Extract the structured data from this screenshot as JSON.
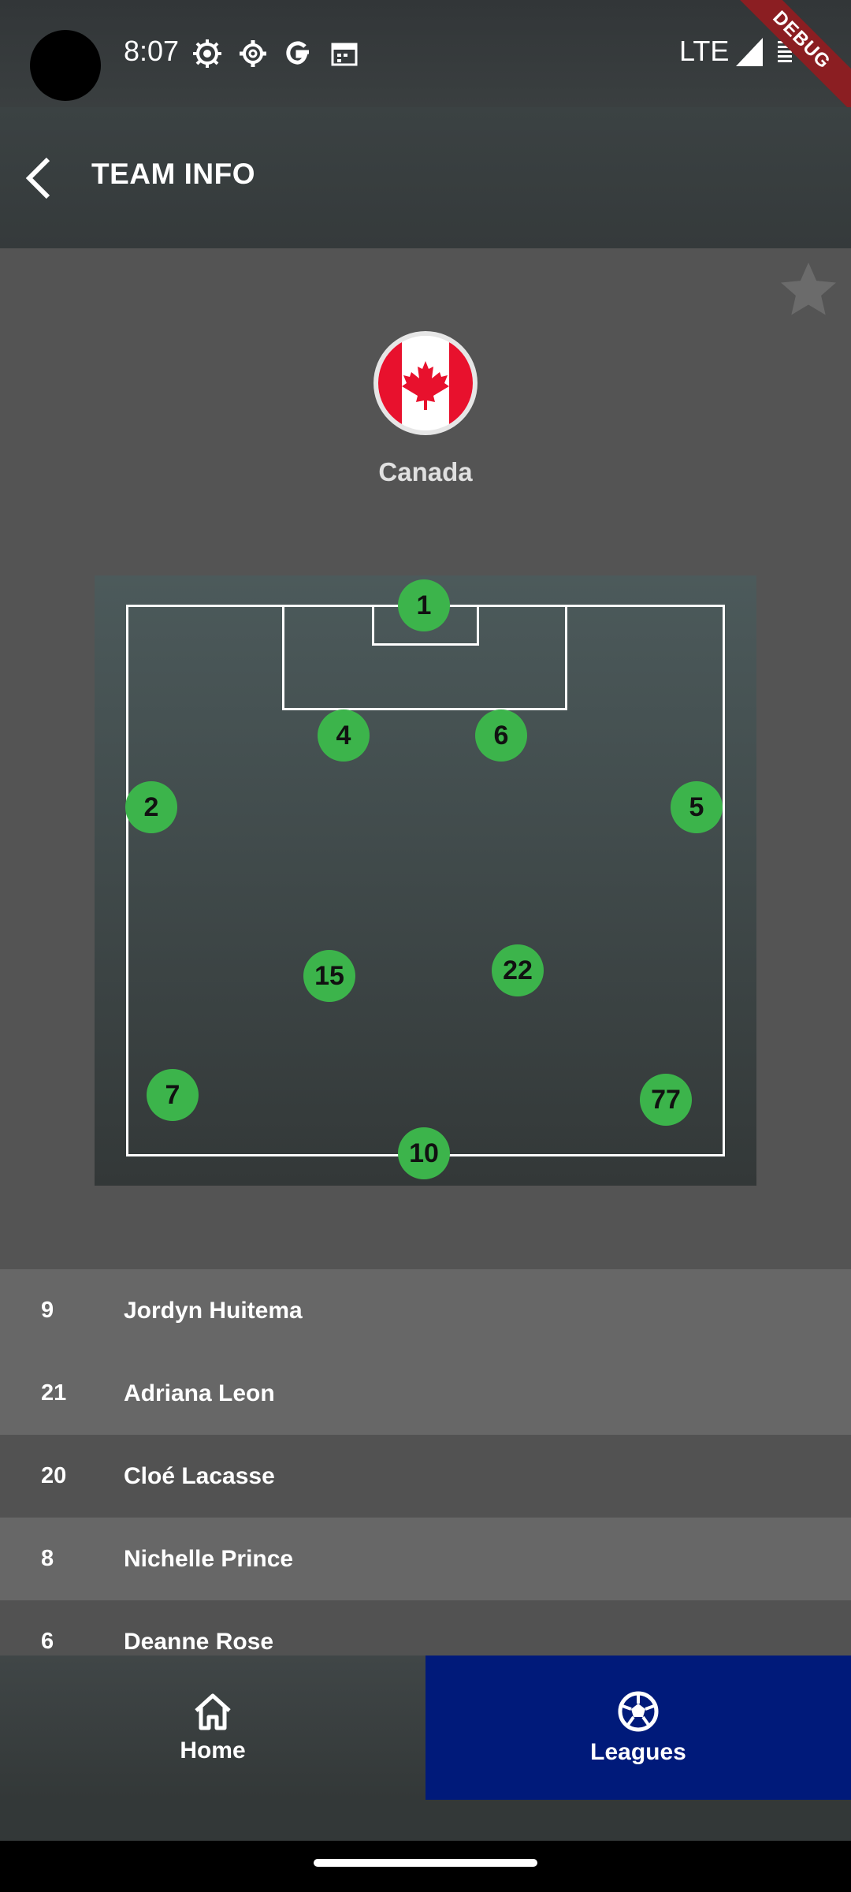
{
  "status_bar": {
    "time": "8:07",
    "network": "LTE",
    "icons": [
      "gear-badge-icon",
      "settings-icon",
      "google-icon",
      "calendar-icon",
      "signal-icon",
      "battery-icon"
    ],
    "debug_label": "DEBUG"
  },
  "app_bar": {
    "title": "TEAM INFO",
    "back_icon": "chevron-left-icon"
  },
  "team": {
    "name": "Canada",
    "flag": "canada-flag",
    "favorite_icon": "star-icon"
  },
  "formation": {
    "players": [
      {
        "number": "1"
      },
      {
        "number": "4"
      },
      {
        "number": "6"
      },
      {
        "number": "2"
      },
      {
        "number": "5"
      },
      {
        "number": "15"
      },
      {
        "number": "22"
      },
      {
        "number": "7"
      },
      {
        "number": "77"
      },
      {
        "number": "10"
      }
    ]
  },
  "roster": [
    {
      "number": "9",
      "name": "Jordyn Huitema"
    },
    {
      "number": "21",
      "name": "Adriana Leon"
    },
    {
      "number": "20",
      "name": "Cloé Lacasse"
    },
    {
      "number": "8",
      "name": "Nichelle Prince"
    },
    {
      "number": "6",
      "name": "Deanne Rose"
    }
  ],
  "bottom_nav": {
    "home_label": "Home",
    "leagues_label": "Leagues",
    "active": "Leagues"
  },
  "colors": {
    "accent": "#001a7a",
    "player_marker": "#3cb44b",
    "debug_ribbon": "#8b1e22"
  }
}
